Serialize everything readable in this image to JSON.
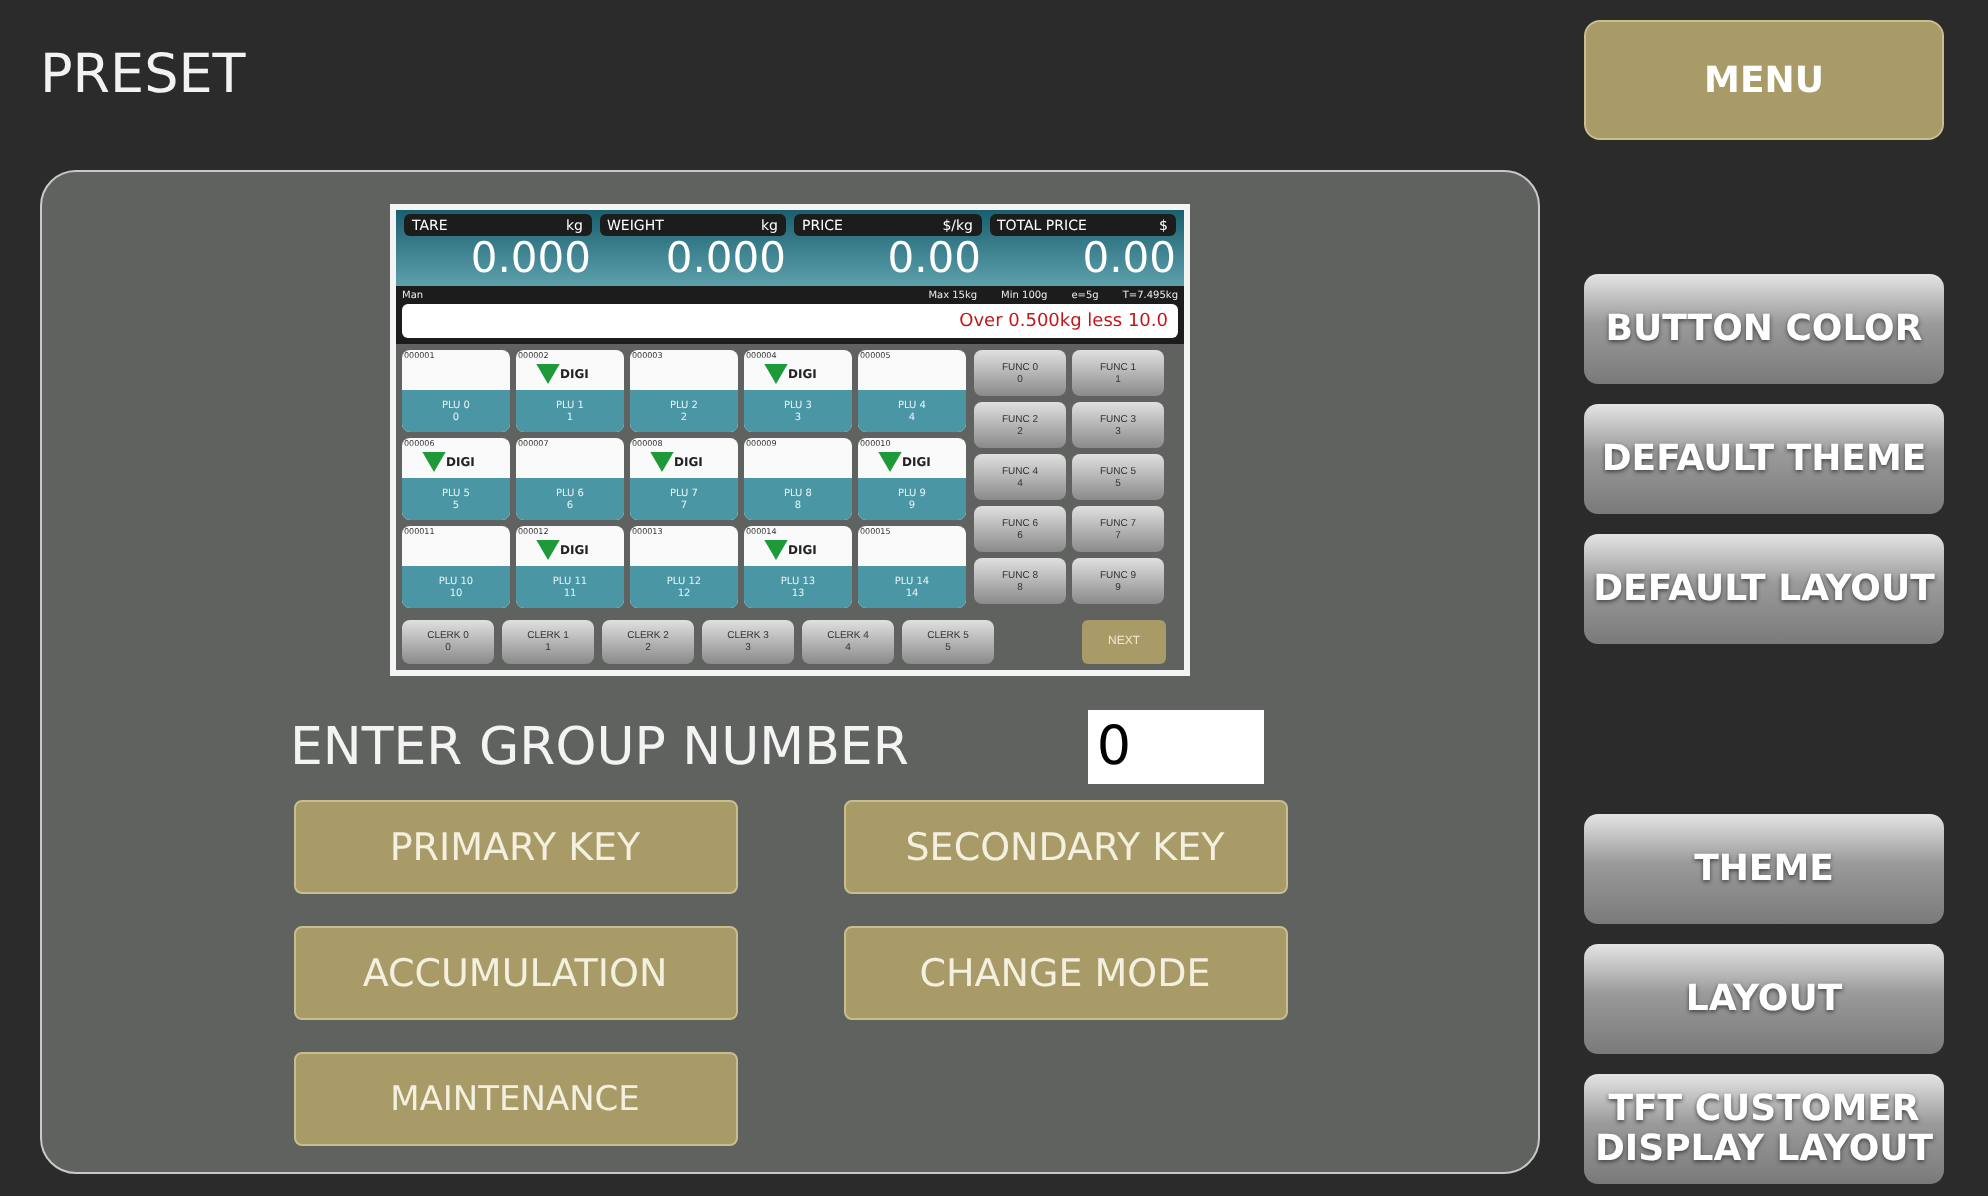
{
  "title": "PRESET",
  "menu_button": "MENU",
  "preview": {
    "displays": [
      {
        "label": "TARE",
        "unit": "kg",
        "value": "0.000"
      },
      {
        "label": "WEIGHT",
        "unit": "kg",
        "value": "0.000"
      },
      {
        "label": "PRICE",
        "unit": "$/kg",
        "value": "0.00"
      },
      {
        "label": "TOTAL PRICE",
        "unit": "$",
        "value": "0.00"
      }
    ],
    "info_left": "Man",
    "info_right": [
      "Max 15kg",
      "Min 100g",
      "e=5g",
      "T=7.495kg"
    ],
    "message": "Over 0.500kg less 10.0",
    "plu_keys": [
      {
        "code": "000001",
        "name": "PLU 0",
        "number": "0"
      },
      {
        "code": "000002",
        "name": "PLU 1",
        "number": "1",
        "logo": "DIGI"
      },
      {
        "code": "000003",
        "name": "PLU 2",
        "number": "2"
      },
      {
        "code": "000004",
        "name": "PLU 3",
        "number": "3",
        "logo": "DIGI"
      },
      {
        "code": "000005",
        "name": "PLU 4",
        "number": "4"
      },
      {
        "code": "000006",
        "name": "PLU 5",
        "number": "5",
        "logo": "DIGI"
      },
      {
        "code": "000007",
        "name": "PLU 6",
        "number": "6"
      },
      {
        "code": "000008",
        "name": "PLU 7",
        "number": "7",
        "logo": "DIGI"
      },
      {
        "code": "000009",
        "name": "PLU 8",
        "number": "8"
      },
      {
        "code": "000010",
        "name": "PLU 9",
        "number": "9",
        "logo": "DIGI"
      },
      {
        "code": "000011",
        "name": "PLU 10",
        "number": "10"
      },
      {
        "code": "000012",
        "name": "PLU 11",
        "number": "11",
        "logo": "DIGI"
      },
      {
        "code": "000013",
        "name": "PLU 12",
        "number": "12"
      },
      {
        "code": "000014",
        "name": "PLU 13",
        "number": "13",
        "logo": "DIGI"
      },
      {
        "code": "000015",
        "name": "PLU 14",
        "number": "14"
      }
    ],
    "func_keys": [
      {
        "name": "FUNC 0",
        "number": "0"
      },
      {
        "name": "FUNC 1",
        "number": "1"
      },
      {
        "name": "FUNC 2",
        "number": "2"
      },
      {
        "name": "FUNC 3",
        "number": "3"
      },
      {
        "name": "FUNC 4",
        "number": "4"
      },
      {
        "name": "FUNC 5",
        "number": "5"
      },
      {
        "name": "FUNC 6",
        "number": "6"
      },
      {
        "name": "FUNC 7",
        "number": "7"
      },
      {
        "name": "FUNC 8",
        "number": "8"
      },
      {
        "name": "FUNC 9",
        "number": "9"
      }
    ],
    "clerk_keys": [
      {
        "name": "CLERK 0",
        "number": "0"
      },
      {
        "name": "CLERK 1",
        "number": "1"
      },
      {
        "name": "CLERK 2",
        "number": "2"
      },
      {
        "name": "CLERK 3",
        "number": "3"
      },
      {
        "name": "CLERK 4",
        "number": "4"
      },
      {
        "name": "CLERK 5",
        "number": "5"
      }
    ],
    "next_button": "NEXT"
  },
  "group_number": {
    "label": "ENTER GROUP NUMBER",
    "value": "0"
  },
  "key_buttons": [
    "PRIMARY KEY",
    "SECONDARY KEY",
    "ACCUMULATION",
    "CHANGE MODE",
    "MAINTENANCE"
  ],
  "side_buttons": [
    {
      "label": "BUTTON COLOR"
    },
    {
      "label": "DEFAULT THEME"
    },
    {
      "label": "DEFAULT LAYOUT"
    },
    {
      "kind": "spacer"
    },
    {
      "label": "THEME"
    },
    {
      "label": "LAYOUT"
    },
    {
      "label": "TFT CUSTOMER DISPLAY LAYOUT"
    }
  ]
}
